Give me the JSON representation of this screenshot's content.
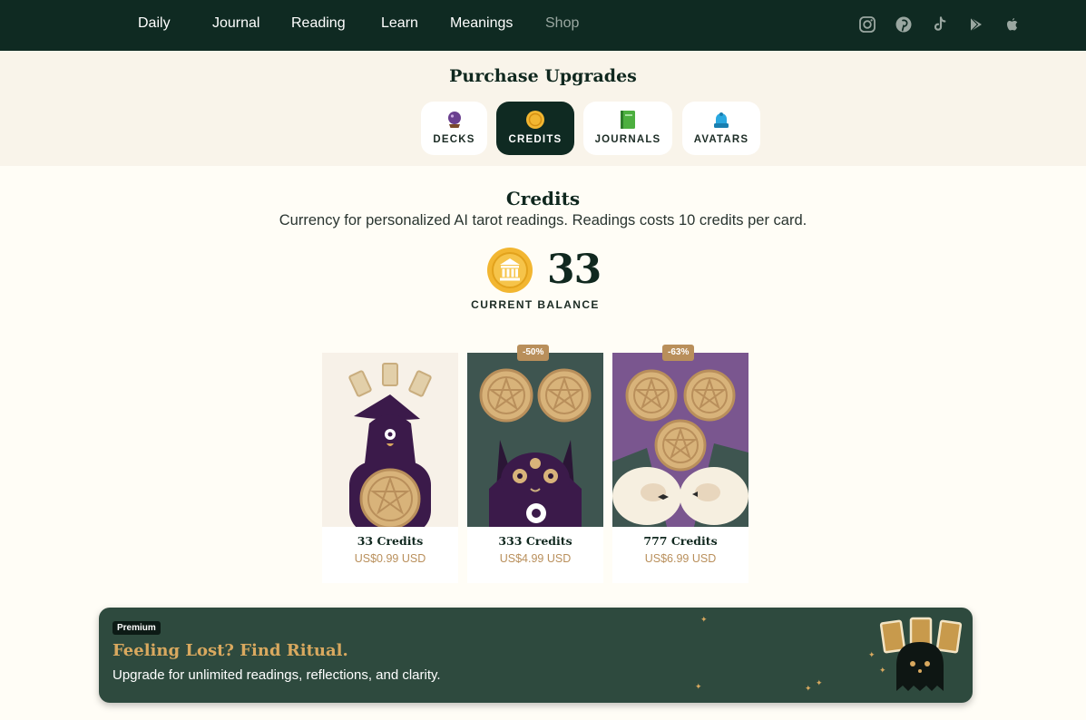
{
  "nav": {
    "links": [
      "Daily",
      "Journal",
      "Reading",
      "Learn",
      "Meanings",
      "Shop"
    ],
    "active": "Shop",
    "social": [
      "instagram-icon",
      "pinterest-icon",
      "tiktok-icon",
      "google-play-icon",
      "apple-icon"
    ]
  },
  "upgrades": {
    "title": "Purchase Upgrades",
    "tabs": [
      {
        "label": "DECKS",
        "icon": "crystal-ball-icon"
      },
      {
        "label": "CREDITS",
        "icon": "coin-icon"
      },
      {
        "label": "JOURNALS",
        "icon": "book-icon"
      },
      {
        "label": "AVATARS",
        "icon": "avatar-icon"
      }
    ],
    "active_tab": "CREDITS"
  },
  "credits": {
    "title": "Credits",
    "description": "Currency for personalized AI tarot readings. Readings costs 10 credits per card.",
    "balance": "33",
    "balance_label": "CURRENT BALANCE"
  },
  "products": [
    {
      "name": "33 Credits",
      "price": "US$0.99 USD",
      "discount": ""
    },
    {
      "name": "333 Credits",
      "price": "US$4.99 USD",
      "discount": "-50%"
    },
    {
      "name": "777 Credits",
      "price": "US$6.99 USD",
      "discount": "-63%"
    }
  ],
  "premium": {
    "badge": "Premium",
    "headline": "Feeling Lost? Find Ritual.",
    "subtext": "Upgrade for unlimited readings, reflections, and clarity."
  },
  "colors": {
    "nav_bg": "#0f2a22",
    "band_bg": "#f9f4ea",
    "page_bg": "#fffdf6",
    "accent_gold": "#b98f5b",
    "coin": "#f2b631",
    "premium_bg": "#2e4a3e",
    "purple": "#3b1a4a"
  }
}
